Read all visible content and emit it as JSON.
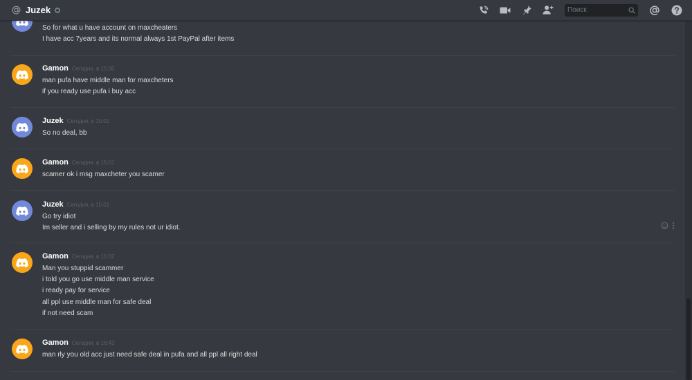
{
  "header": {
    "channel_name": "Juzek",
    "search_placeholder": "Поиск",
    "icons": [
      "at-sign-icon",
      "status-offline-icon",
      "call-icon",
      "video-icon",
      "pin-icon",
      "add-friend-icon",
      "search-icon",
      "mentions-icon",
      "help-icon"
    ]
  },
  "messages": [
    {
      "author": "",
      "timestamp": "",
      "avatar_color": "#7289da",
      "lines": [
        "So for what u have account on maxcheaters",
        "I have acc 7years and its normal always 1st PayPal after items"
      ]
    },
    {
      "author": "Gamon",
      "timestamp": "Сегодня, в 15:00",
      "avatar_color": "#faa61a",
      "lines": [
        "man pufa have  middle man for maxcheters",
        "if you ready use pufa i buy acc"
      ]
    },
    {
      "author": "Juzek",
      "timestamp": "Сегодня, в 15:01",
      "avatar_color": "#7289da",
      "lines": [
        "So no deal, bb"
      ]
    },
    {
      "author": "Gamon",
      "timestamp": "Сегодня, в 15:01",
      "avatar_color": "#faa61a",
      "lines": [
        "scamer ok i msg maxcheter you scamer"
      ]
    },
    {
      "author": "Juzek",
      "timestamp": "Сегодня, в 15:01",
      "avatar_color": "#7289da",
      "lines": [
        "Go try idiot",
        "Im seller and i selling by my rules not ur idiot."
      ]
    },
    {
      "author": "Gamon",
      "timestamp": "Сегодня, в 15:02",
      "avatar_color": "#faa61a",
      "lines": [
        "Man you stuppid scammer",
        "i told you go use middle man service",
        "i ready pay for service",
        "all ppl use middle man for safe deal",
        "if not need scam"
      ]
    },
    {
      "author": "Gamon",
      "timestamp": "Сегодня, в 16:43",
      "avatar_color": "#faa61a",
      "lines": [
        "man rly you old acc just need safe deal in pufa and all ppl all right deal"
      ]
    }
  ],
  "message_actions": [
    "add-reaction-icon",
    "more-options-icon"
  ]
}
